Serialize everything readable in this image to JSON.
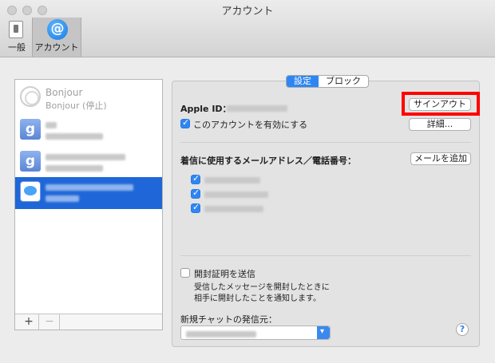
{
  "window": {
    "title": "アカウント"
  },
  "toolbar": {
    "items": [
      {
        "label": "一般",
        "icon": "switch-icon"
      },
      {
        "label": "アカウント",
        "icon": "at-icon",
        "selected": true
      }
    ]
  },
  "accounts": [
    {
      "name": "Bonjour",
      "status": "Bonjour (停止)",
      "icon": "bonjour-icon"
    },
    {
      "name": "",
      "status": "",
      "icon": "google-icon",
      "redacted": true
    },
    {
      "name": "",
      "status": "",
      "icon": "google-icon",
      "redacted": true
    },
    {
      "name": "",
      "status": "",
      "icon": "messages-icon",
      "redacted": true,
      "selected": true
    }
  ],
  "list_footer": {
    "add": "+",
    "remove": "−"
  },
  "tabs": {
    "settings": "設定",
    "block": "ブロック",
    "active": "settings"
  },
  "account_settings": {
    "apple_id_label": "Apple ID：",
    "sign_out_button": "サインアウト",
    "enable_account_label": "このアカウントを有効にする",
    "enable_account_checked": true,
    "details_button": "詳細..."
  },
  "addresses": {
    "label": "着信に使用するメールアドレス／電話番号：",
    "add_email_button": "メールを追加",
    "items_checked": [
      true,
      true,
      true
    ]
  },
  "receipts": {
    "label": "開封証明を送信",
    "checked": false,
    "description_line1": "受信したメッセージを開封したときに",
    "description_line2": "相手に開封したことを通知します。"
  },
  "new_chat": {
    "label": "新規チャットの発信元："
  },
  "help_button": "?",
  "colors": {
    "accent": "#2f86f3",
    "highlight": "#ff0000",
    "selection": "#1f67d8"
  }
}
